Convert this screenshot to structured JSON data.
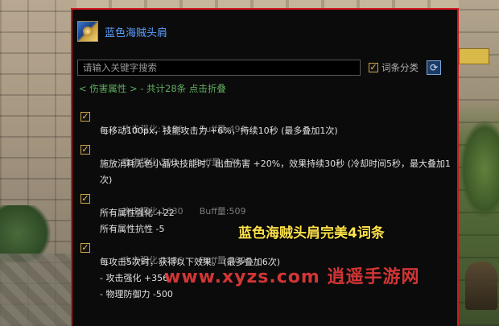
{
  "item": {
    "name": "蓝色海贼头肩",
    "icon": "pirate-shoulder-item-icon"
  },
  "search": {
    "placeholder": "请输入关键字搜索",
    "category_label": "词条分类",
    "category_checked": true
  },
  "summary": "< 伤害属性 > - 共计28条 点击折叠",
  "entries": [
    {
      "checked": true,
      "name": "攻击强化:1186",
      "buff": "Buff量:494",
      "lines": [
        "每移动100px，技能攻击力 +6%，持续10秒 (最多叠加1次)"
      ]
    },
    {
      "checked": true,
      "name": "攻击强化:593",
      "buff": "Buff量:474",
      "lines": [
        "施放消耗无色小晶块技能时，出血伤害 +20%，效果持续30秒 (冷却时间5秒，最大叠加1次)"
      ]
    },
    {
      "checked": true,
      "name": "攻击强化:1630",
      "buff": "Buff量:509",
      "lines": [
        "所有属性强化 +22",
        "所有属性抗性 -5"
      ]
    },
    {
      "checked": true,
      "name": "攻击强化:1186",
      "buff": "Buff量:509",
      "lines": [
        "每攻击5次时，获得以下效果。 (最多叠加6次)",
        "- 攻击强化 +356",
        "- 物理防御力 -500"
      ]
    }
  ],
  "overlay": {
    "title": "蓝色海贼头肩完美4词条",
    "watermark": "www.xyzs.com 逍遥手游网"
  },
  "colors": {
    "border": "#d1161f",
    "item_name": "#5aa0ff",
    "summary": "#5fae5f",
    "overlay_title": "#ffe24a",
    "watermark": "#e83a3a"
  }
}
